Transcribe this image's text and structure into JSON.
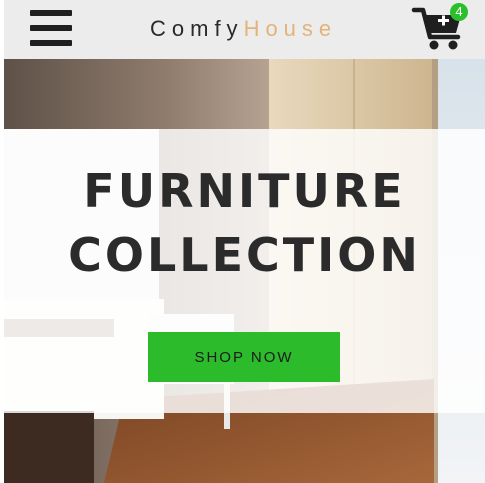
{
  "navbar": {
    "brand_part1": "Comfy",
    "brand_part2": "House",
    "cart_count": "4"
  },
  "hero": {
    "title_line1": "FURNITURE",
    "title_line2": "COLLECTION",
    "button_label": "SHOP NOW"
  },
  "colors": {
    "navbar_bg": "#ececec",
    "brand_accent": "#e3b37a",
    "button_bg": "#2bbb2b",
    "badge_bg": "#2bbf2b"
  },
  "icons": [
    "menu-icon",
    "cart-icon"
  ]
}
